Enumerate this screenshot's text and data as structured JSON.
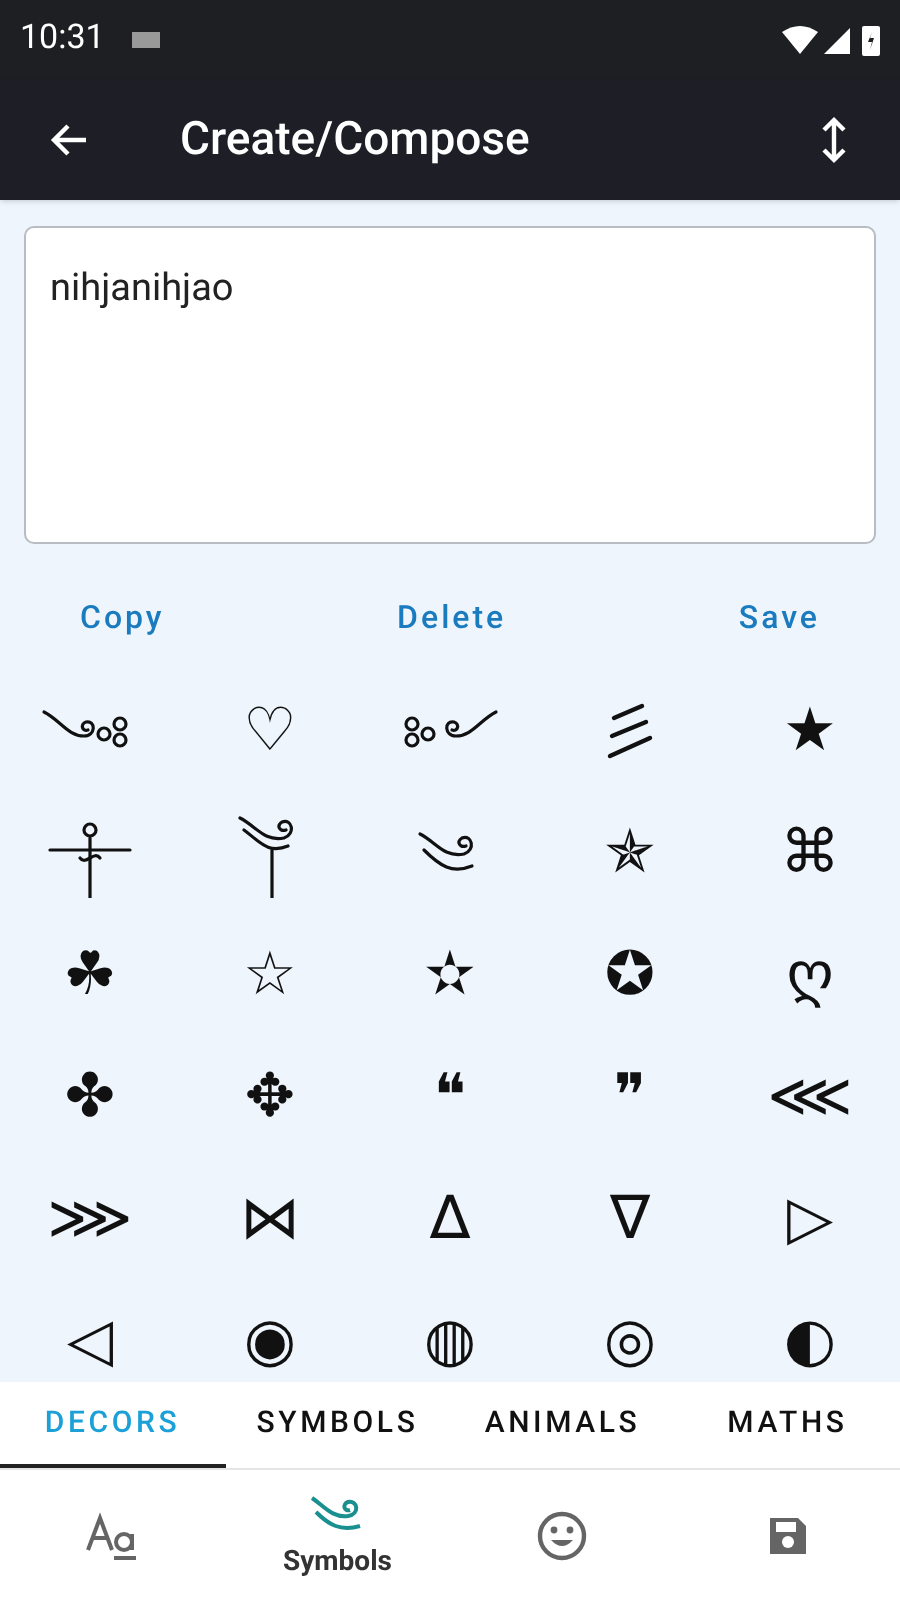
{
  "status_bar": {
    "time": "10:31"
  },
  "app_bar": {
    "title": "Create/Compose"
  },
  "editor": {
    "value": "nihjanihjao"
  },
  "actions": [
    "Copy",
    "Delete",
    "Save"
  ],
  "symbols": [
    {
      "kind": "swirldots"
    },
    {
      "kind": "glyph",
      "text": "♡"
    },
    {
      "kind": "dotsswirl"
    },
    {
      "kind": "strokes"
    },
    {
      "kind": "glyph",
      "text": "★"
    },
    {
      "kind": "cross"
    },
    {
      "kind": "swirlstem"
    },
    {
      "kind": "swirl"
    },
    {
      "kind": "glyph",
      "text": "✯"
    },
    {
      "kind": "glyph",
      "text": "⌘"
    },
    {
      "kind": "glyph",
      "text": "☘"
    },
    {
      "kind": "glyph",
      "text": "☆"
    },
    {
      "kind": "glyph",
      "text": "✫"
    },
    {
      "kind": "glyph",
      "text": "✪"
    },
    {
      "kind": "glyph",
      "text": "ღ"
    },
    {
      "kind": "glyph",
      "text": "✤"
    },
    {
      "kind": "glyph",
      "text": "✥"
    },
    {
      "kind": "glyph",
      "text": "❝"
    },
    {
      "kind": "glyph",
      "text": "❞"
    },
    {
      "kind": "glyph",
      "text": "⋘"
    },
    {
      "kind": "glyph",
      "text": "⋙"
    },
    {
      "kind": "glyph",
      "text": "⋈"
    },
    {
      "kind": "glyph",
      "text": "∆"
    },
    {
      "kind": "glyph",
      "text": "∇"
    },
    {
      "kind": "glyph",
      "text": "▷"
    },
    {
      "kind": "glyph",
      "text": "◁"
    },
    {
      "kind": "glyph",
      "text": "◉"
    },
    {
      "kind": "glyph",
      "text": "◍"
    },
    {
      "kind": "glyph",
      "text": "◎"
    },
    {
      "kind": "glyph",
      "text": "◐"
    }
  ],
  "tabs": [
    {
      "label": "DECORS",
      "selected": true
    },
    {
      "label": "SYMBOLS",
      "selected": false
    },
    {
      "label": "ANIMALS",
      "selected": false
    },
    {
      "label": "MATHS",
      "selected": false
    }
  ],
  "bottom_nav": [
    {
      "kind": "fonts",
      "selected": false
    },
    {
      "kind": "symbols",
      "label": "Symbols",
      "selected": true
    },
    {
      "kind": "emoji",
      "selected": false
    },
    {
      "kind": "save",
      "selected": false
    }
  ]
}
